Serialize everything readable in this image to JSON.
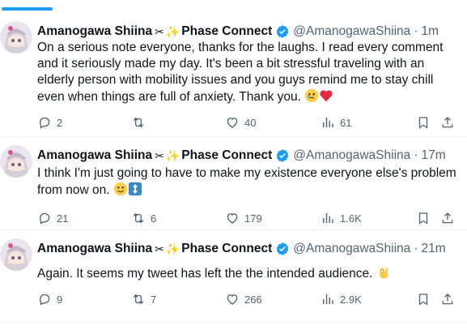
{
  "colors": {
    "accent": "#1d9bf0",
    "text": "#0f1419",
    "muted": "#536471",
    "verified": "#1d9bf0",
    "heart": "#e0245e"
  },
  "tweets": [
    {
      "name": "Amanogawa Shiina",
      "name_suffix": "Phase Connect",
      "handle": "@AmanogawaShiina",
      "time": "1m",
      "lines": [
        "On a serious note everyone, thanks for the laughs. I read every comment",
        "and it seriously made my day. It's been a bit stressful traveling with an",
        "elderly person with mobility issues and you guys remind me to stay chill",
        "even when things are full of anxiety. Thank you."
      ],
      "emojis": [
        "face-holding-back-tears-icon",
        "red-heart-icon"
      ],
      "replies": "2",
      "reposts": "",
      "likes": "40",
      "views": "61"
    },
    {
      "name": "Amanogawa Shiina",
      "name_suffix": "Phase Connect",
      "handle": "@AmanogawaShiina",
      "time": "17m",
      "lines": [
        "I think I'm just going to have to make my existence everyone else's problem",
        "from now on."
      ],
      "emojis": [
        "slightly-smiling-face-icon",
        "up-down-arrow-icon"
      ],
      "replies": "21",
      "reposts": "6",
      "likes": "179",
      "views": "1.6K"
    },
    {
      "name": "Amanogawa Shiina",
      "name_suffix": "Phase Connect",
      "handle": "@AmanogawaShiina",
      "time": "21m",
      "lines": [
        "Again. It seems my tweet has left the the intended audience."
      ],
      "emojis": [
        "ok-hand-icon"
      ],
      "replies": "9",
      "reposts": "7",
      "likes": "266",
      "views": "2.9K"
    }
  ]
}
